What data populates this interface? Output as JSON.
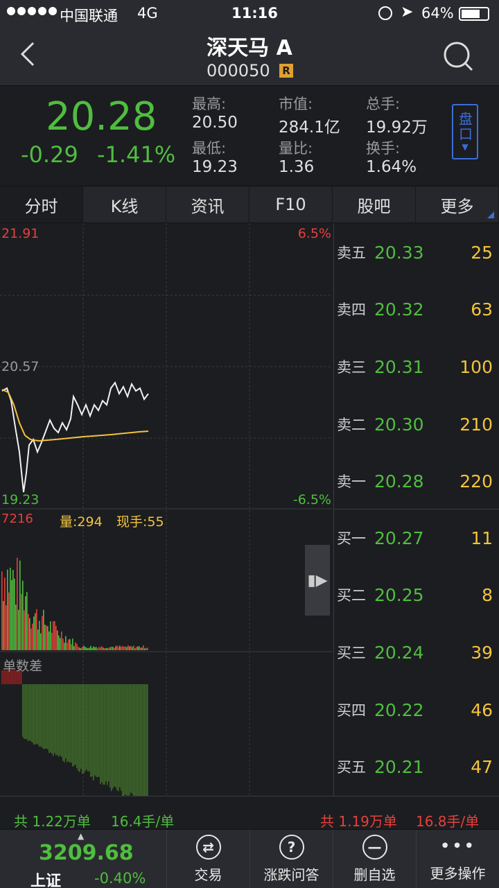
{
  "status_bar": {
    "carrier": "中国联通",
    "network": "4G",
    "time": "11:16",
    "battery": "64%"
  },
  "nav": {
    "title": "深天马 A",
    "code": "000050",
    "badge": "R"
  },
  "quote": {
    "price": "20.28",
    "change": "-0.29",
    "change_pct": "-1.41%",
    "stats": [
      {
        "label": "最高:",
        "value": "20.50"
      },
      {
        "label": "市值:",
        "value": "284.1亿"
      },
      {
        "label": "总手:",
        "value": "19.92万"
      },
      {
        "label": "最低:",
        "value": "19.23"
      },
      {
        "label": "量比:",
        "value": "1.36"
      },
      {
        "label": "换手:",
        "value": "1.64%"
      }
    ],
    "panel_button": "盘口"
  },
  "tabs": [
    "分时",
    "K线",
    "资讯",
    "F10",
    "股吧",
    "更多"
  ],
  "chart": {
    "price_high": "21.91",
    "price_mid": "20.57",
    "price_low": "19.23",
    "pct_high": "6.5%",
    "pct_low": "-6.5%",
    "vol_max": "7216",
    "vol_label": "量:294",
    "now_label": "现手:55",
    "diff_label": "单数差"
  },
  "order_book": [
    {
      "label": "卖五",
      "price": "20.33",
      "volume": "25"
    },
    {
      "label": "卖四",
      "price": "20.32",
      "volume": "63"
    },
    {
      "label": "卖三",
      "price": "20.31",
      "volume": "100"
    },
    {
      "label": "卖二",
      "price": "20.30",
      "volume": "210"
    },
    {
      "label": "卖一",
      "price": "20.28",
      "volume": "220"
    },
    {
      "label": "买一",
      "price": "20.27",
      "volume": "11"
    },
    {
      "label": "买二",
      "price": "20.25",
      "volume": "8"
    },
    {
      "label": "买三",
      "price": "20.24",
      "volume": "39"
    },
    {
      "label": "买四",
      "price": "20.22",
      "volume": "46"
    },
    {
      "label": "买五",
      "price": "20.21",
      "volume": "47"
    }
  ],
  "summary": {
    "buy_total": "共 1.22万单",
    "buy_avg": "16.4手/单",
    "sell_total": "共 1.19万单",
    "sell_avg": "16.8手/单"
  },
  "bottom_bar": {
    "index_value": "3209.68",
    "index_name": "上证",
    "index_change": "-0.40%",
    "items": [
      {
        "label": "交易",
        "icon": "trade-icon"
      },
      {
        "label": "涨跌问答",
        "icon": "question-icon"
      },
      {
        "label": "删自选",
        "icon": "remove-icon"
      },
      {
        "label": "更多操作",
        "icon": "more-icon"
      }
    ]
  },
  "colors": {
    "up": "#e6403a",
    "down": "#4fbe3e",
    "accent": "#f4c43a",
    "highlight_blue": "#3a6fd8"
  }
}
